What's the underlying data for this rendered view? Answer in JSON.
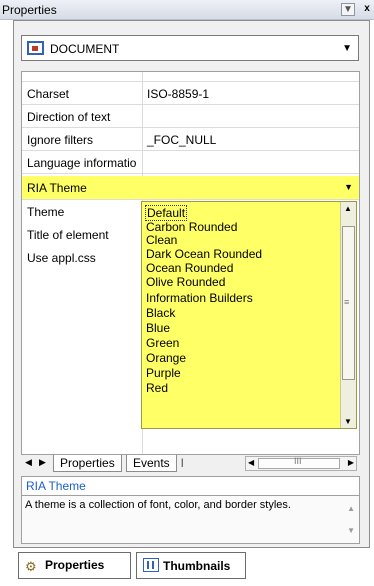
{
  "window": {
    "title": "Properties",
    "close_label": "x",
    "pin_label": "▼"
  },
  "object_selector": {
    "value": "DOCUMENT"
  },
  "properties": [
    {
      "name": "Charset",
      "value": "ISO-8859-1"
    },
    {
      "name": "Direction of text",
      "value": ""
    },
    {
      "name": "Ignore filters",
      "value": "_FOC_NULL"
    },
    {
      "name": "Language informatio",
      "value": ""
    },
    {
      "name": "RIA Theme",
      "value": ""
    },
    {
      "name": "Theme",
      "value": ""
    },
    {
      "name": "Title of element",
      "value": ""
    },
    {
      "name": "Use appl.css",
      "value": ""
    }
  ],
  "theme_options": {
    "selected": "Default",
    "items": [
      "Default",
      "Carbon Rounded",
      "Clean",
      "Dark Ocean Rounded",
      "Ocean Rounded",
      "Olive Rounded",
      "Information Builders",
      "Black",
      "Blue",
      "Green",
      "Orange",
      "Purple",
      "Red"
    ]
  },
  "inner_tabs": [
    {
      "label": "Properties"
    },
    {
      "label": "Events"
    }
  ],
  "description": {
    "title": "RIA Theme",
    "text": "A theme is a collection of font, color, and border styles."
  },
  "bottom_tabs": [
    {
      "label": "Properties"
    },
    {
      "label": "Thumbnails"
    }
  ],
  "colors": {
    "highlight": "#ffff66",
    "accent": "#1c5fc8"
  }
}
